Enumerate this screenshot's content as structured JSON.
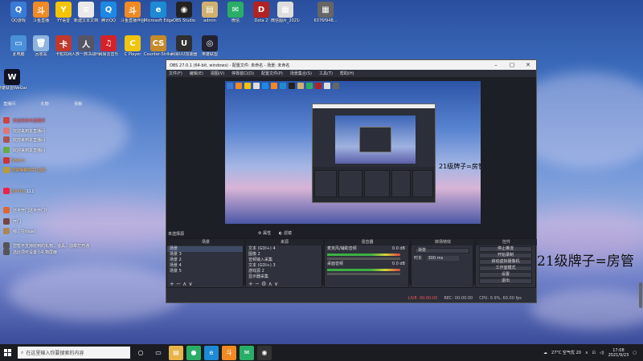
{
  "desktop_icons": [
    {
      "label": "QQ游戏",
      "color": "#3a7bd5",
      "glyph": "Q"
    },
    {
      "label": "斗鱼直播",
      "color": "#f08a24",
      "glyph": "斗"
    },
    {
      "label": "YY语音",
      "color": "#f5c400",
      "glyph": "Y"
    },
    {
      "label": "新建文本文档",
      "color": "#e9e9e9",
      "glyph": "≡"
    },
    {
      "label": "腾讯QQ",
      "color": "#1e88e5",
      "glyph": "Q"
    },
    {
      "label": "斗鱼直播伴侣",
      "color": "#f08a24",
      "glyph": "斗"
    },
    {
      "label": "Microsoft Edge",
      "color": "#1f8ad4",
      "glyph": "e"
    },
    {
      "label": "OBS Studio",
      "color": "#222",
      "glyph": "◉"
    },
    {
      "label": "admin",
      "color": "#d0b070",
      "glyph": "▤"
    },
    {
      "label": "微信",
      "color": "#2aae67",
      "glyph": "✉"
    },
    {
      "label": "Dota 2",
      "color": "#b22222",
      "glyph": "D"
    },
    {
      "label": "微信图片_2021091...",
      "color": "#ddd",
      "glyph": "▦"
    },
    {
      "label": "6376f94B...",
      "color": "#666",
      "glyph": "▦"
    },
    {
      "label": "此电脑",
      "color": "#4a90d9",
      "glyph": "▭"
    },
    {
      "label": "回收站",
      "color": "#8fb4dc",
      "glyph": "🗑"
    },
    {
      "label": "卡帕充网",
      "color": "#c0392b",
      "glyph": "卡"
    },
    {
      "label": "人族一族决战Human Fa...",
      "color": "#556",
      "glyph": "人"
    },
    {
      "label": "网易云音乐",
      "color": "#d3232a",
      "glyph": "♫"
    },
    {
      "label": "C Player",
      "color": "#f1c40f",
      "glyph": "C"
    },
    {
      "label": "Counter-Strike Global...",
      "color": "#c68a2b",
      "glyph": "CS"
    },
    {
      "label": "网易UU加速器",
      "color": "#2f2f2f",
      "glyph": "U"
    },
    {
      "label": "英雄联盟",
      "color": "#223",
      "glyph": "◎"
    },
    {
      "label": "英雄联盟WeGame版",
      "color": "#112",
      "glyph": "W"
    },
    {
      "label": "英雄联盟",
      "color": "#c49a34",
      "glyph": "L"
    },
    {
      "label": "英雄联盟",
      "color": "#2a2a2a",
      "glyph": "◈"
    },
    {
      "label": "英雄联盟",
      "color": "#c8a200",
      "glyph": "英"
    }
  ],
  "chat": {
    "header_a": "直播间",
    "header_b": "礼物",
    "header_c": "贡献",
    "lines": [
      {
        "name": "",
        "text": "欢迎来到本直播间",
        "red": true
      },
      {
        "name": "",
        "text": "欢迎来到本直播间",
        "red": false
      },
      {
        "name": "",
        "text": "欢迎来到本直播间",
        "red": false
      },
      {
        "name": "",
        "text": "欢迎来到本直播间",
        "red": false
      },
      {
        "name": "Sekero",
        "text": "",
        "red": false
      },
      {
        "name": "感谢弹幕助手(@区)",
        "text": "",
        "red": false
      },
      {
        "name": "Jianing",
        "text": "111",
        "red": false
      },
      {
        "name": "",
        "text": "还不开门这不开门?",
        "red": false
      },
      {
        "name": "",
        "text": "开门",
        "red": false
      },
      {
        "name": "",
        "text": "嗯，在mua?",
        "red": false
      },
      {
        "name": "",
        "text": "您暂不支持收到的礼物、道具、勋章打开通",
        "red": false
      },
      {
        "name": "",
        "text": "选此项可设置小礼物屏蔽",
        "red": false
      }
    ]
  },
  "obs": {
    "title": "OBS 27.0.1 (64-bit, windows) - 配置文件: 未命名 - 场景: 未命名",
    "menu": [
      "文件(F)",
      "编辑(E)",
      "视图(V)",
      "停靠窗口(D)",
      "配置文件(P)",
      "场景集合(S)",
      "工具(T)",
      "帮助(H)"
    ],
    "preview_caption": "21级牌子=房管",
    "source_selected_label": "未选择源",
    "properties_btn": "属性",
    "filters_btn": "滤镜",
    "docks": {
      "scenes": {
        "title": "场景",
        "items": [
          "场景",
          "场景 3",
          "场景 2",
          "场景 4",
          "场景 5"
        ]
      },
      "sources": {
        "title": "来源",
        "items": [
          "文本 (GDI+) 4",
          "图像 2",
          "音频输入采集",
          "文本 (GDI+) 3",
          "游戏源 2",
          "显示器采集"
        ]
      },
      "mixer": {
        "title": "混音器",
        "items": [
          "麦克风/辅助音频",
          "桌面音频"
        ],
        "values": [
          "0.0 dB",
          "0.0 dB"
        ]
      },
      "transitions": {
        "title": "转场特效",
        "type": "渐变",
        "duration_label": "时长",
        "duration": "300 ms"
      },
      "controls": {
        "title": "控件",
        "buttons": [
          "停止推流",
          "开始录制",
          "启动虚拟摄像机",
          "工作室模式",
          "设置",
          "退出"
        ]
      }
    },
    "status": {
      "live": "LIVE: 00:00:00",
      "rec": "REC: 00:00:00",
      "cpu": "CPU: 0.9%, 60.00 fps"
    }
  },
  "overlay_caption": "21级牌子=房管",
  "taskbar": {
    "search_placeholder": "在这里输入你要搜索的内容",
    "weather": "27°C 空气优 20",
    "time": "17:08",
    "date": "2021/9/23"
  }
}
